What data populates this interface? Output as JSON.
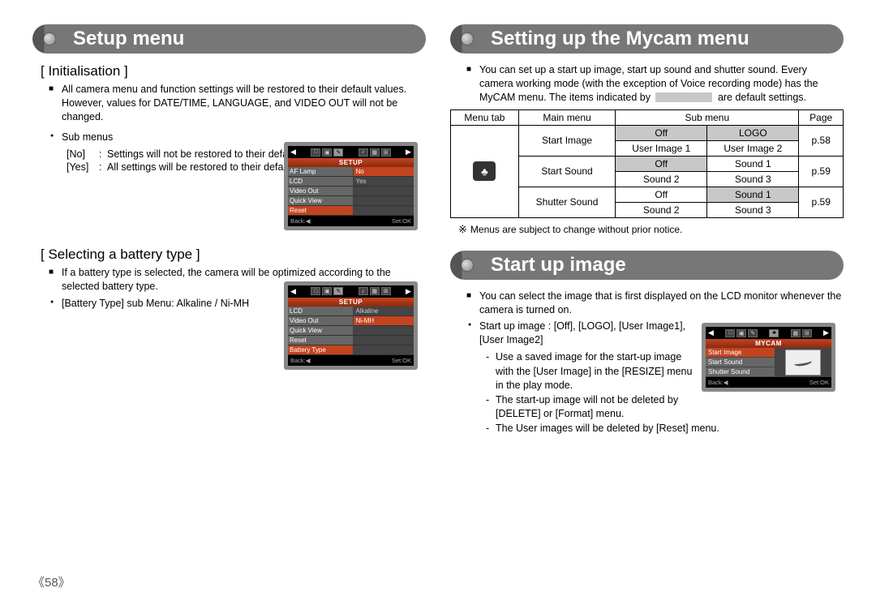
{
  "left": {
    "banner": "Setup menu",
    "init": {
      "title": "[ Initialisation ]",
      "desc": "All camera menu and function settings will be restored to their default values. However, values for DATE/TIME, LANGUAGE, and VIDEO OUT will not be changed.",
      "submenus_label": "Sub menus",
      "no_label": "[No]",
      "no_desc": "Settings will not be restored to their defaults.",
      "yes_label": "[Yes]",
      "yes_desc": "All settings will be restored to their defaults.",
      "shot": {
        "head": "SETUP",
        "rows": [
          {
            "l": "AF Lamp",
            "r": "No",
            "lsel": false,
            "rsel": true
          },
          {
            "l": "LCD",
            "r": "Yes",
            "lsel": false,
            "rsel": false
          },
          {
            "l": "Video Out",
            "r": "",
            "lsel": false,
            "rsel": false
          },
          {
            "l": "Quick View",
            "r": "",
            "lsel": false,
            "rsel": false
          },
          {
            "l": "Reset",
            "r": "",
            "lsel": true,
            "rsel": false
          }
        ],
        "back": "Back:◀",
        "set": "Set:OK"
      }
    },
    "batt": {
      "title": "[ Selecting a battery type ]",
      "desc": "If a battery type is selected, the camera will be optimized according to the selected battery type.",
      "sub": "[Battery Type] sub Menu: Alkaline / Ni-MH",
      "shot": {
        "head": "SETUP",
        "rows": [
          {
            "l": "LCD",
            "r": "Alkaline",
            "lsel": false,
            "rsel": false
          },
          {
            "l": "Video Out",
            "r": "Ni-MH",
            "lsel": false,
            "rsel": true
          },
          {
            "l": "Quick View",
            "r": "",
            "lsel": false,
            "rsel": false
          },
          {
            "l": "Reset",
            "r": "",
            "lsel": false,
            "rsel": false
          },
          {
            "l": "Battery Type",
            "r": "",
            "lsel": true,
            "rsel": false
          }
        ],
        "back": "Back:◀",
        "set": "Set:OK"
      }
    }
  },
  "right": {
    "banner1": "Setting up the Mycam menu",
    "intro1": "You can set up a start up image, start up sound and shutter sound. Every camera working mode (with the exception of Voice recording mode) has the MyCAM menu. The items indicated by",
    "intro2": "are default settings.",
    "table": {
      "headers": [
        "Menu tab",
        "Main menu",
        "Sub menu",
        "Page"
      ],
      "rows": [
        {
          "main": "Start Image",
          "c1": "Off",
          "c2": "LOGO",
          "c3": "User Image 1",
          "c4": "User Image 2",
          "page": "p.58",
          "s1": true,
          "s2": true
        },
        {
          "main": "Start Sound",
          "c1": "Off",
          "c2": "Sound 1",
          "c3": "Sound 2",
          "c4": "Sound 3",
          "page": "p.59",
          "s1": true,
          "s2": false
        },
        {
          "main": "Shutter Sound",
          "c1": "Off",
          "c2": "Sound 1",
          "c3": "Sound 2",
          "c4": "Sound 3",
          "page": "p.59",
          "s1": false,
          "s2": true
        }
      ]
    },
    "note": "Menus are subject to change without prior notice.",
    "banner2": "Start up image",
    "sui_desc": "You can select the image that is first displayed on the LCD monitor whenever the camera is turned on.",
    "sui_opts": "Start up image : [Off], [LOGO], [User Image1], [User Image2]",
    "sui_sub1": "Use a saved image for the start-up image with the [User Image] in the [RESIZE] menu in the play mode.",
    "sui_sub2": "The start-up image will not be deleted by [DELETE] or [Format] menu.",
    "sui_sub3": "The User images will be deleted by [Reset] menu.",
    "shot": {
      "head": "MYCAM",
      "rows": [
        "Start Image",
        "Start Sound",
        "Shutter Sound"
      ],
      "back": "Back:◀",
      "set": "Set:OK"
    }
  },
  "page_number": "《58》"
}
